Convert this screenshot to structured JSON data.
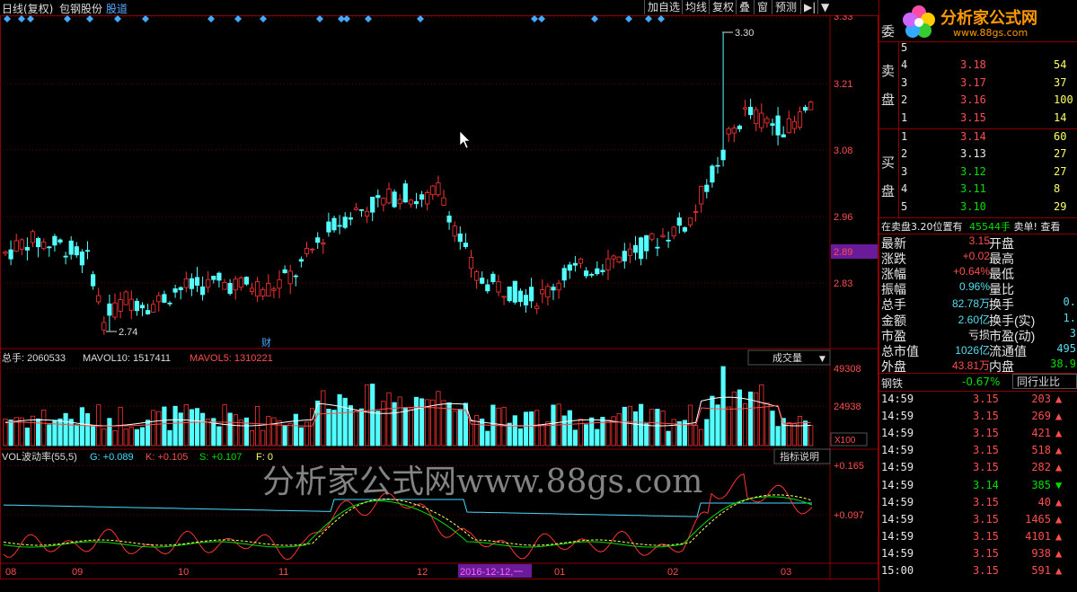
{
  "topbar": {
    "title_label": "日线(复权)",
    "stock_name": "包钢股份",
    "stock_tag": "股道",
    "buttons": [
      "加自选",
      "均线",
      "复权",
      "叠",
      "窗",
      "预测"
    ],
    "nav_icon": "play-arrow-icon",
    "dropdown_icon": "triangle-down-icon"
  },
  "price_axis": [
    "3.33",
    "3.21",
    "3.08",
    "2.96",
    "2.83"
  ],
  "current_price_tag": "2.89",
  "price_annotations": {
    "high": "3.30",
    "low": "2.74"
  },
  "financial_marker": "财",
  "volume_header": {
    "total": "总手: 2060533",
    "mavol10": "MAVOL10: 1517411",
    "mavol5": "MAVOL5: 1310221",
    "selector": "成交量"
  },
  "volume_axis": [
    "49308",
    "24938"
  ],
  "volume_unit": "X100",
  "indicator_header": {
    "name": "VOL波动率(55,5)",
    "g": "G: +0.089",
    "k": "K: +0.105",
    "s": "S: +0.107",
    "f": "F: 0",
    "help_button": "指标说明"
  },
  "indicator_axis": [
    "+0.165",
    "+0.097"
  ],
  "watermark": "分析家公式网www.88gs.com",
  "time_axis": [
    "08",
    "09",
    "10",
    "11",
    "12",
    "01",
    "02",
    "03"
  ],
  "cursor_date": "2016-12-12,一",
  "colors": {
    "up": "#ff3333",
    "down": "#54ffff",
    "axis": "#8b0000",
    "ma5": "#ffffff",
    "ma10": "#ffff00"
  },
  "panel": {
    "logo": "分析家公式网",
    "logo_url": "www.88gs.com",
    "weibi_label": "委",
    "sell_label_1": "卖",
    "sell_label_2": "盘",
    "buy_label_1": "买",
    "buy_label_2": "盘",
    "asks": [
      {
        "lvl": "5",
        "price": "",
        "vol": ""
      },
      {
        "lvl": "4",
        "price": "3.18",
        "vol": "54"
      },
      {
        "lvl": "3",
        "price": "3.17",
        "vol": "37"
      },
      {
        "lvl": "2",
        "price": "3.16",
        "vol": "100"
      },
      {
        "lvl": "1",
        "price": "3.15",
        "vol": "14"
      }
    ],
    "bids": [
      {
        "lvl": "1",
        "price": "3.14",
        "vol": "60"
      },
      {
        "lvl": "2",
        "price": "3.13",
        "vol": "27"
      },
      {
        "lvl": "3",
        "price": "3.12",
        "vol": "27"
      },
      {
        "lvl": "4",
        "price": "3.11",
        "vol": "8"
      },
      {
        "lvl": "5",
        "price": "3.10",
        "vol": "29"
      }
    ],
    "alert": {
      "text": "在卖盘3.20位置有",
      "vol": "45544手",
      "tail": "卖单! 查看"
    },
    "stats": [
      {
        "l": "最新",
        "v": "3.15",
        "l2": "开盘",
        "v2": ""
      },
      {
        "l": "涨跌",
        "v": "+0.02",
        "l2": "最高",
        "v2": ""
      },
      {
        "l": "涨幅",
        "v": "+0.64%",
        "l2": "最低",
        "v2": ""
      },
      {
        "l": "振幅",
        "v": "0.96%",
        "l2": "量比",
        "v2": ""
      },
      {
        "l": "总手",
        "v": "82.78万",
        "l2": "换手",
        "v2": "0."
      },
      {
        "l": "金额",
        "v": "2.60亿",
        "l2": "换手(实)",
        "v2": "1."
      },
      {
        "l": "市盈",
        "v": "亏损",
        "l2": "市盈(动)",
        "v2": "3"
      },
      {
        "l": "总市值",
        "v": "1026亿",
        "l2": "流通值",
        "v2": "495"
      },
      {
        "l": "外盘",
        "v": "43.81万",
        "l2": "内盘",
        "v2": "38.9"
      }
    ],
    "sector": {
      "name": "钢铁",
      "change": "-0.67%",
      "button": "同行业比"
    },
    "ticks": [
      {
        "t": "14:59",
        "p": "3.15",
        "v": "203",
        "d": "up"
      },
      {
        "t": "14:59",
        "p": "3.15",
        "v": "269",
        "d": "up"
      },
      {
        "t": "14:59",
        "p": "3.15",
        "v": "421",
        "d": "up"
      },
      {
        "t": "14:59",
        "p": "3.15",
        "v": "518",
        "d": "up"
      },
      {
        "t": "14:59",
        "p": "3.15",
        "v": "282",
        "d": "up"
      },
      {
        "t": "14:59",
        "p": "3.14",
        "v": "385",
        "d": "down"
      },
      {
        "t": "14:59",
        "p": "3.15",
        "v": "40",
        "d": "up"
      },
      {
        "t": "14:59",
        "p": "3.15",
        "v": "1465",
        "d": "up"
      },
      {
        "t": "14:59",
        "p": "3.15",
        "v": "4101",
        "d": "up"
      },
      {
        "t": "14:59",
        "p": "3.15",
        "v": "938",
        "d": "up"
      },
      {
        "t": "15:00",
        "p": "3.15",
        "v": "591",
        "d": "up"
      }
    ]
  }
}
